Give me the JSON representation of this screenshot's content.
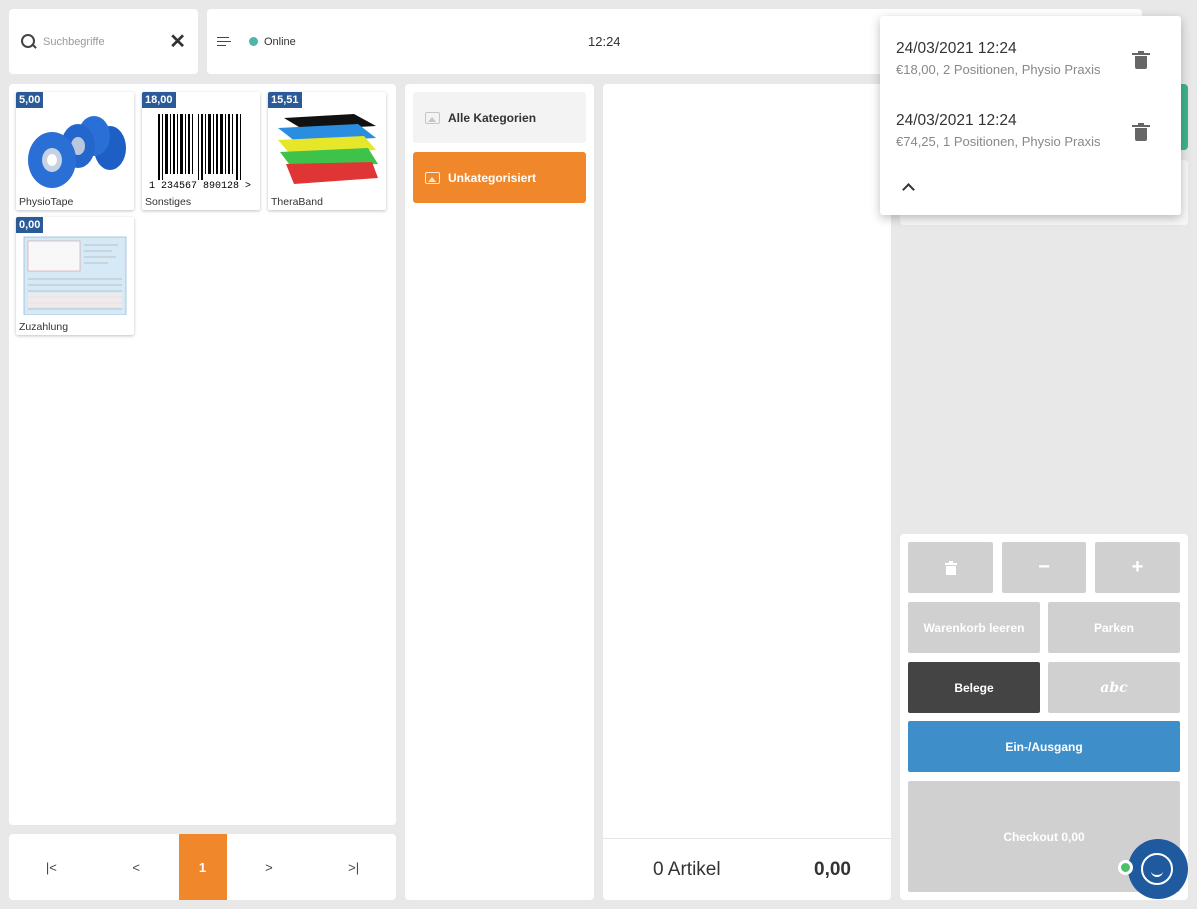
{
  "search": {
    "placeholder": "Suchbegriffe"
  },
  "topbar": {
    "status": "Online",
    "time": "12:24",
    "status_color": "#4db6ac"
  },
  "products": [
    {
      "price": "5,00",
      "name": "PhysioTape",
      "icon": "physio-tape-image"
    },
    {
      "price": "18,00",
      "name": "Sonstiges",
      "icon": "barcode-image",
      "barcode_text": "1 234567 890128 >"
    },
    {
      "price": "15,51",
      "name": "TheraBand",
      "icon": "theraband-image"
    },
    {
      "price": "0,00",
      "name": "Zuzahlung",
      "icon": "form-document-image"
    }
  ],
  "pager": {
    "first": "|<",
    "prev": "<",
    "current": "1",
    "next": ">",
    "last": ">|"
  },
  "categories": [
    {
      "label": "Alle Kategorien"
    },
    {
      "label": "Unkategorisiert"
    }
  ],
  "cart": {
    "count_label": "0 Artikel",
    "total": "0,00"
  },
  "keypad": {
    "minus": "−",
    "plus": "+",
    "clear_cart": "Warenkorb leeren",
    "park": "Parken",
    "receipts": "Belege",
    "abc": "abc",
    "cash_in_out": "Ein-/Ausgang",
    "checkout": "Checkout  0,00"
  },
  "parked_carts": [
    {
      "title": "24/03/2021 12:24",
      "subtitle": "€18,00, 2 Positionen, Physio Praxis"
    },
    {
      "title": "24/03/2021 12:24",
      "subtitle": "€74,25, 1 Positionen, Physio Praxis"
    }
  ],
  "colors": {
    "accent": "#f0872a",
    "price_badge": "#2a5a97",
    "blue_button": "#3d8ec9",
    "dark_button": "#444444"
  }
}
